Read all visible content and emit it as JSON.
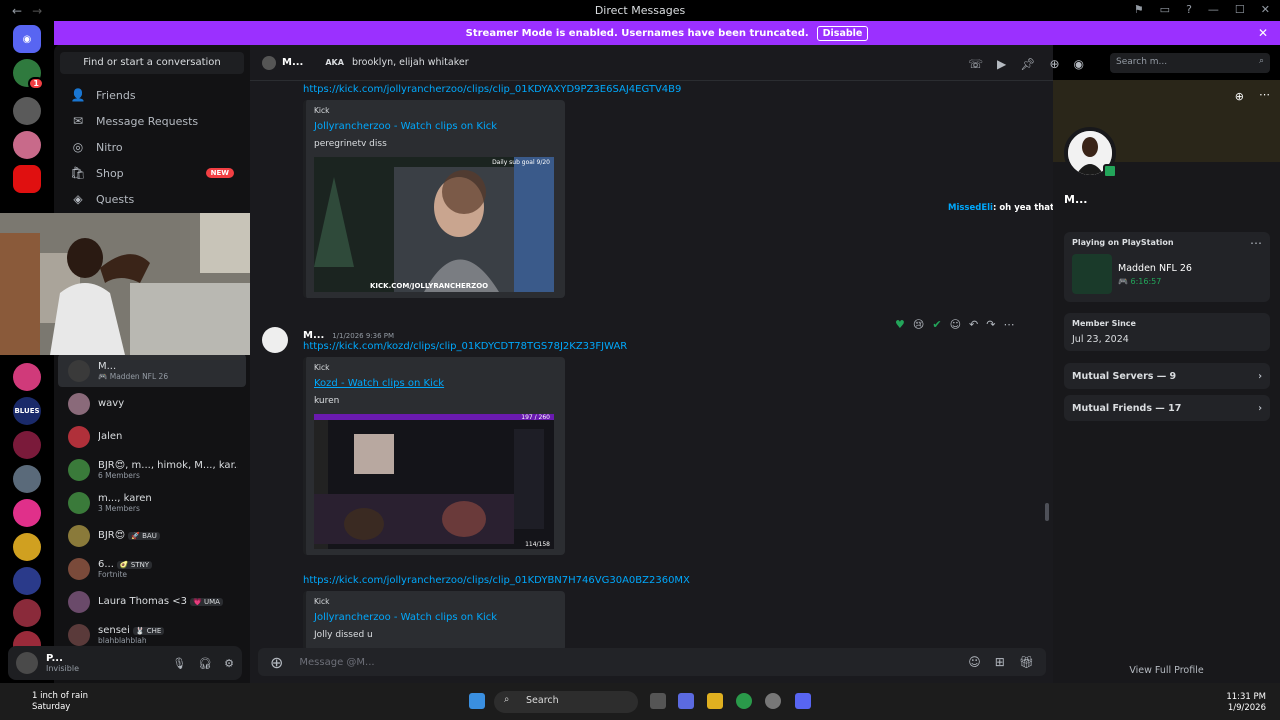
{
  "titlebar": {
    "title": "Direct Messages"
  },
  "banner": {
    "text": "Streamer Mode is enabled. Usernames have been truncated.",
    "button": "Disable"
  },
  "sidebar": {
    "find": "Find or start a conversation",
    "nav": [
      {
        "label": "Friends",
        "icon": "friends-icon"
      },
      {
        "label": "Message Requests",
        "icon": "mail-icon"
      },
      {
        "label": "Nitro",
        "icon": "nitro-icon"
      },
      {
        "label": "Shop",
        "icon": "shop-icon",
        "badge": "NEW"
      },
      {
        "label": "Quests",
        "icon": "quests-icon"
      }
    ],
    "dms": [
      {
        "name": "M...",
        "sub": "Madden NFL 26",
        "active": true,
        "color": "#3a3a3a"
      },
      {
        "name": "wavy",
        "sub": "",
        "color": "#8a6a7a"
      },
      {
        "name": "Jalen",
        "sub": "",
        "color": "#b0303a"
      },
      {
        "name": "BJR😍, m..., himok, M..., kar...",
        "sub": "6 Members",
        "color": "#3a7a3a"
      },
      {
        "name": "m..., karen",
        "sub": "3 Members",
        "color": "#3a7a3a"
      },
      {
        "name": "BJR😍",
        "tag": "🚀 BAU",
        "sub": "",
        "color": "#8a7a3a"
      },
      {
        "name": "6...",
        "tag": "🥑 STNY",
        "sub": "Fortnite",
        "color": "#7a4a3a"
      },
      {
        "name": "Laura Thomas <3",
        "tag": "💗 UMA",
        "sub": "",
        "color": "#6a4a6a"
      },
      {
        "name": "sensei",
        "tag": "🐰 CHE",
        "sub": "blahblahblah",
        "color": "#5a3a3a"
      }
    ]
  },
  "user": {
    "name": "P...",
    "status": "Invisible"
  },
  "chat": {
    "header_name": "M...",
    "aka": "AKA",
    "aka_names": "brooklyn, elijah whitaker",
    "search_placeholder": "Search m...",
    "messages": [
      {
        "link": "https://kick.com/jollyrancherzoo/clips/clip_01KDYAXYD9PZ3E6SAJ4EGTV4B9",
        "provider": "Kick",
        "title": "Jollyrancherzoo - Watch clips on Kick",
        "desc": "peregrinetv diss",
        "thumb_caption": "Daily sub goal 9/20",
        "thumb_url": "KICK.COM/JOLLYRANCHERZOO"
      },
      {
        "author": "M...",
        "time": "1/1/2026 9:36 PM",
        "link": "https://kick.com/kozd/clips/clip_01KDYCDT78TGS78J2KZ33FJWAR",
        "provider": "Kick",
        "title": "Kozd - Watch clips on Kick",
        "desc": "kuren",
        "thumb_caption": "197 / 260",
        "thumb_count": "114/158"
      },
      {
        "link": "https://kick.com/jollyrancherzoo/clips/clip_01KDYBN7H746VG30A0BZ2360MX",
        "provider": "Kick",
        "title": "Jollyrancherzoo - Watch clips on Kick",
        "desc": "Jolly dissed u"
      }
    ],
    "overlay_user": "MissedEli",
    "overlay_text": ": oh yea that bridge never existed bro",
    "input_placeholder": "Message @M..."
  },
  "profile": {
    "name": "M...",
    "playing_label": "Playing on PlayStation",
    "game": "Madden NFL 26",
    "game_time": "6:16:57",
    "member_since_label": "Member Since",
    "member_since": "Jul 23, 2024",
    "mutual_servers": "Mutual Servers — 9",
    "mutual_friends": "Mutual Friends — 17",
    "view_full": "View Full Profile"
  },
  "taskbar": {
    "weather_line1": "1 inch of rain",
    "weather_line2": "Saturday",
    "search": "Search",
    "time": "11:31 PM",
    "date": "1/9/2026"
  },
  "colors": {
    "accent": "#9b30ff",
    "link": "#00a8fc",
    "online": "#23a55a"
  }
}
